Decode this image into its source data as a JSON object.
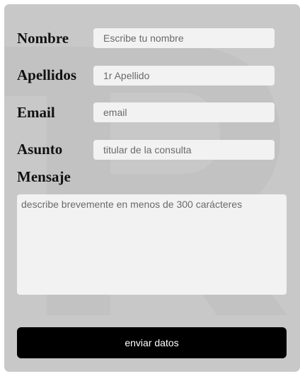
{
  "form": {
    "fields": {
      "nombre": {
        "label": "Nombre",
        "placeholder": "Escribe tu nombre",
        "value": ""
      },
      "apellidos": {
        "label": "Apellidos",
        "placeholder": "1r Apellido",
        "value": ""
      },
      "email": {
        "label": "Email",
        "placeholder": "email",
        "value": ""
      },
      "asunto": {
        "label": "Asunto",
        "placeholder": "titular de la consulta",
        "value": ""
      }
    },
    "mensaje": {
      "label": "Mensaje",
      "placeholder": "describe brevemente en menos de 300 carácteres",
      "value": ""
    },
    "submit_label": "enviar datos"
  },
  "colors": {
    "card_background": "#c8c8c8",
    "field_background": "#f2f2f2",
    "button_background": "#000000",
    "button_text": "#ffffff"
  },
  "icons": {
    "watermark": "letter-r-watermark-icon"
  }
}
